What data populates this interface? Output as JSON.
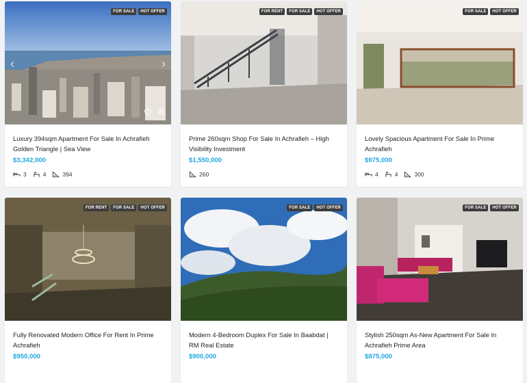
{
  "listings": [
    {
      "badges": [
        "FOR SALE",
        "HOT OFFER"
      ],
      "title": "Luxury 394sqm Apartment For Sale In Achrafieh Golden Triangle | Sea View",
      "price": "$3,342,000",
      "specs": {
        "beds": "3",
        "baths": "4",
        "area": "394"
      }
    },
    {
      "badges": [
        "FOR RENT",
        "FOR SALE",
        "HOT OFFER"
      ],
      "title": "Prime 260sqm Shop For Sale In Achrafieh – High Visibility Investment",
      "price": "$1,550,000",
      "specs": {
        "area": "260"
      }
    },
    {
      "badges": [
        "FOR SALE",
        "HOT OFFER"
      ],
      "title": "Lovely Spacious Apartment For Sale In Prime Achrafieh",
      "price": "$975,000",
      "specs": {
        "beds": "4",
        "baths": "4",
        "area": "300"
      }
    },
    {
      "badges": [
        "FOR RENT",
        "FOR SALE",
        "HOT OFFER"
      ],
      "title": "Fully Renovated Modern Office For Rent In Prime Achrafieh",
      "price": "$950,000"
    },
    {
      "badges": [
        "FOR SALE",
        "HOT OFFER"
      ],
      "title": "Modern 4-Bedroom Duplex For Sale In Baabdat | RM Real Estate",
      "price": "$900,000"
    },
    {
      "badges": [
        "FOR SALE",
        "HOT OFFER"
      ],
      "title": "Stylish 250sqm As-New Apartment For Sale In Achrafieh Prime Area",
      "price": "$875,000"
    }
  ]
}
